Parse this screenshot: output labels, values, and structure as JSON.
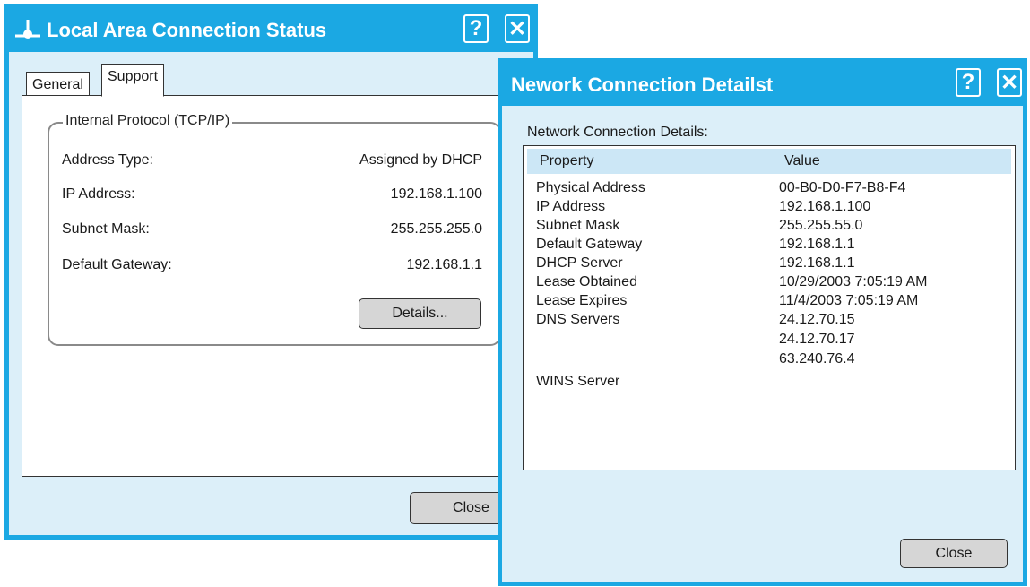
{
  "status_window": {
    "title": "Local Area Connection Status",
    "help_glyph": "?",
    "close_glyph": "✕",
    "tabs": [
      "General",
      "Support"
    ],
    "active_tab": "Support",
    "group_label": "Internal Protocol (TCP/IP)",
    "fields": [
      {
        "label": "Address Type:",
        "value": "Assigned by DHCP"
      },
      {
        "label": "IP Address:",
        "value": "192.168.1.100"
      },
      {
        "label": "Subnet Mask:",
        "value": "255.255.255.0"
      },
      {
        "label": "Default Gateway:",
        "value": "192.168.1.1"
      }
    ],
    "details_button": "Details...",
    "close_button": "Close",
    "icon": "network-connection-icon"
  },
  "details_window": {
    "title": "Nework Connection Detailst",
    "help_glyph": "?",
    "close_glyph": "✕",
    "caption": "Network Connection Details:",
    "columns": [
      "Property",
      "Value"
    ],
    "rows": [
      {
        "property": "Physical Address",
        "value": "00-B0-D0-F7-B8-F4"
      },
      {
        "property": "IP Address",
        "value": "192.168.1.100"
      },
      {
        "property": "Subnet Mask",
        "value": "255.255.55.0"
      },
      {
        "property": "Default Gateway",
        "value": "192.168.1.1"
      },
      {
        "property": "DHCP Server",
        "value": "192.168.1.1"
      },
      {
        "property": "Lease Obtained",
        "value": "10/29/2003 7:05:19 AM"
      },
      {
        "property": "Lease Expires",
        "value": "11/4/2003 7:05:19 AM"
      },
      {
        "property": "DNS Servers",
        "value": "24.12.70.15"
      },
      {
        "property": "",
        "value": "24.12.70.17"
      },
      {
        "property": "",
        "value": "63.240.76.4"
      },
      {
        "property": "WINS Server",
        "value": ""
      }
    ],
    "close_button": "Close"
  },
  "colors": {
    "title_bar": "#1ba8e3",
    "window_body": "#dceff9",
    "list_header": "#cce7f6",
    "button_face": "#d6d6d6"
  }
}
